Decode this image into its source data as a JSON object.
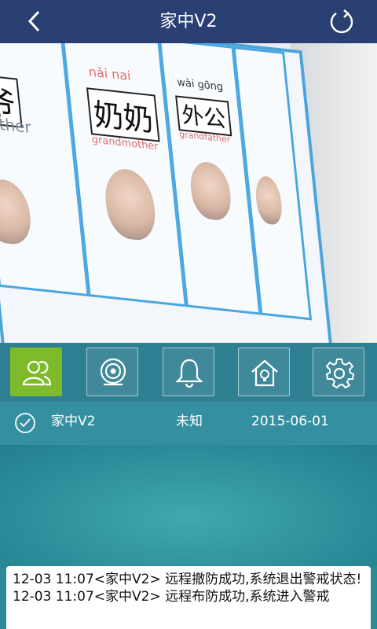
{
  "header": {
    "title": "家中V2"
  },
  "toolbar": {
    "buttons": [
      "contacts-icon",
      "camera-icon",
      "bell-icon",
      "home-icon",
      "gear-icon"
    ]
  },
  "device": {
    "name": "家中V2",
    "status": "未知",
    "date": "2015-06-01"
  },
  "log": {
    "lines": [
      "12-03 11:07<家中V2> 远程撤防成功,系统退出警戒状态!",
      "12-03 11:07<家中V2> 远程布防成功,系统进入警戒"
    ]
  },
  "video": {
    "poster": {
      "pinyin": [
        "nǎi nai",
        "wài gōng"
      ],
      "hanzi": [
        "奶奶",
        "外公",
        "爷"
      ],
      "captions": [
        "grandmother",
        "grandfather",
        "ther"
      ]
    }
  },
  "colors": {
    "header": "#2a3f72",
    "active": "#7dbb2a",
    "panel": "#2f7f92"
  }
}
